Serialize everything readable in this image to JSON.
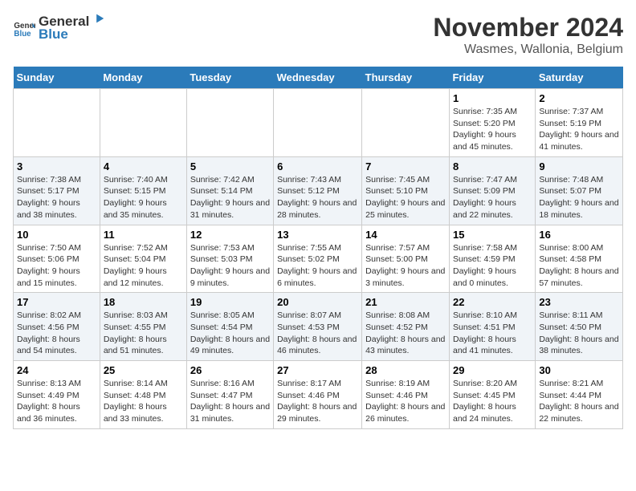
{
  "header": {
    "logo_general": "General",
    "logo_blue": "Blue",
    "title": "November 2024",
    "subtitle": "Wasmes, Wallonia, Belgium"
  },
  "weekdays": [
    "Sunday",
    "Monday",
    "Tuesday",
    "Wednesday",
    "Thursday",
    "Friday",
    "Saturday"
  ],
  "weeks": [
    [
      {
        "day": "",
        "info": ""
      },
      {
        "day": "",
        "info": ""
      },
      {
        "day": "",
        "info": ""
      },
      {
        "day": "",
        "info": ""
      },
      {
        "day": "",
        "info": ""
      },
      {
        "day": "1",
        "info": "Sunrise: 7:35 AM\nSunset: 5:20 PM\nDaylight: 9 hours and 45 minutes."
      },
      {
        "day": "2",
        "info": "Sunrise: 7:37 AM\nSunset: 5:19 PM\nDaylight: 9 hours and 41 minutes."
      }
    ],
    [
      {
        "day": "3",
        "info": "Sunrise: 7:38 AM\nSunset: 5:17 PM\nDaylight: 9 hours and 38 minutes."
      },
      {
        "day": "4",
        "info": "Sunrise: 7:40 AM\nSunset: 5:15 PM\nDaylight: 9 hours and 35 minutes."
      },
      {
        "day": "5",
        "info": "Sunrise: 7:42 AM\nSunset: 5:14 PM\nDaylight: 9 hours and 31 minutes."
      },
      {
        "day": "6",
        "info": "Sunrise: 7:43 AM\nSunset: 5:12 PM\nDaylight: 9 hours and 28 minutes."
      },
      {
        "day": "7",
        "info": "Sunrise: 7:45 AM\nSunset: 5:10 PM\nDaylight: 9 hours and 25 minutes."
      },
      {
        "day": "8",
        "info": "Sunrise: 7:47 AM\nSunset: 5:09 PM\nDaylight: 9 hours and 22 minutes."
      },
      {
        "day": "9",
        "info": "Sunrise: 7:48 AM\nSunset: 5:07 PM\nDaylight: 9 hours and 18 minutes."
      }
    ],
    [
      {
        "day": "10",
        "info": "Sunrise: 7:50 AM\nSunset: 5:06 PM\nDaylight: 9 hours and 15 minutes."
      },
      {
        "day": "11",
        "info": "Sunrise: 7:52 AM\nSunset: 5:04 PM\nDaylight: 9 hours and 12 minutes."
      },
      {
        "day": "12",
        "info": "Sunrise: 7:53 AM\nSunset: 5:03 PM\nDaylight: 9 hours and 9 minutes."
      },
      {
        "day": "13",
        "info": "Sunrise: 7:55 AM\nSunset: 5:02 PM\nDaylight: 9 hours and 6 minutes."
      },
      {
        "day": "14",
        "info": "Sunrise: 7:57 AM\nSunset: 5:00 PM\nDaylight: 9 hours and 3 minutes."
      },
      {
        "day": "15",
        "info": "Sunrise: 7:58 AM\nSunset: 4:59 PM\nDaylight: 9 hours and 0 minutes."
      },
      {
        "day": "16",
        "info": "Sunrise: 8:00 AM\nSunset: 4:58 PM\nDaylight: 8 hours and 57 minutes."
      }
    ],
    [
      {
        "day": "17",
        "info": "Sunrise: 8:02 AM\nSunset: 4:56 PM\nDaylight: 8 hours and 54 minutes."
      },
      {
        "day": "18",
        "info": "Sunrise: 8:03 AM\nSunset: 4:55 PM\nDaylight: 8 hours and 51 minutes."
      },
      {
        "day": "19",
        "info": "Sunrise: 8:05 AM\nSunset: 4:54 PM\nDaylight: 8 hours and 49 minutes."
      },
      {
        "day": "20",
        "info": "Sunrise: 8:07 AM\nSunset: 4:53 PM\nDaylight: 8 hours and 46 minutes."
      },
      {
        "day": "21",
        "info": "Sunrise: 8:08 AM\nSunset: 4:52 PM\nDaylight: 8 hours and 43 minutes."
      },
      {
        "day": "22",
        "info": "Sunrise: 8:10 AM\nSunset: 4:51 PM\nDaylight: 8 hours and 41 minutes."
      },
      {
        "day": "23",
        "info": "Sunrise: 8:11 AM\nSunset: 4:50 PM\nDaylight: 8 hours and 38 minutes."
      }
    ],
    [
      {
        "day": "24",
        "info": "Sunrise: 8:13 AM\nSunset: 4:49 PM\nDaylight: 8 hours and 36 minutes."
      },
      {
        "day": "25",
        "info": "Sunrise: 8:14 AM\nSunset: 4:48 PM\nDaylight: 8 hours and 33 minutes."
      },
      {
        "day": "26",
        "info": "Sunrise: 8:16 AM\nSunset: 4:47 PM\nDaylight: 8 hours and 31 minutes."
      },
      {
        "day": "27",
        "info": "Sunrise: 8:17 AM\nSunset: 4:46 PM\nDaylight: 8 hours and 29 minutes."
      },
      {
        "day": "28",
        "info": "Sunrise: 8:19 AM\nSunset: 4:46 PM\nDaylight: 8 hours and 26 minutes."
      },
      {
        "day": "29",
        "info": "Sunrise: 8:20 AM\nSunset: 4:45 PM\nDaylight: 8 hours and 24 minutes."
      },
      {
        "day": "30",
        "info": "Sunrise: 8:21 AM\nSunset: 4:44 PM\nDaylight: 8 hours and 22 minutes."
      }
    ]
  ]
}
